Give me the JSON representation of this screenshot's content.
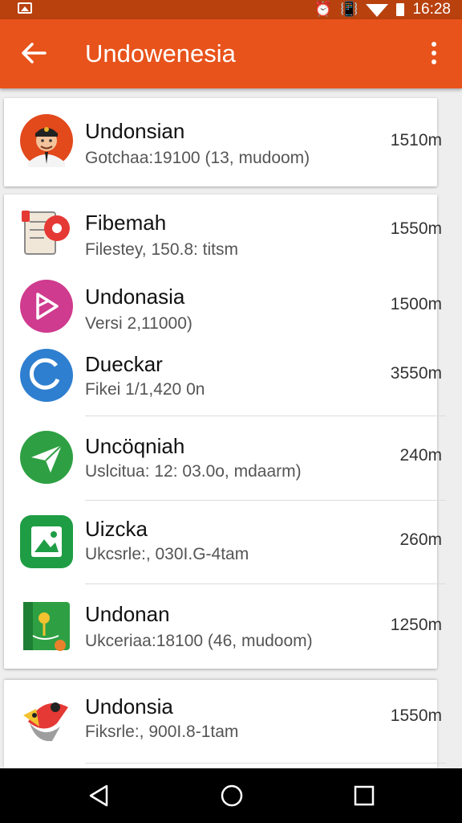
{
  "status_bar": {
    "time": "16:28",
    "icons": [
      "image-icon",
      "alarm-icon",
      "vibrate-icon",
      "wifi-icon",
      "battery-icon"
    ]
  },
  "app_bar": {
    "title": "Undowenesia",
    "back_icon": "arrow-back-icon",
    "menu_icon": "more-vert-icon"
  },
  "colors": {
    "app_bar": "#e8531b",
    "status_bar": "#b8410e"
  },
  "items": [
    {
      "title": "Undonsian",
      "subtitle": "Gotchaa:19100 (13, mudoom)",
      "size": "1510m",
      "icon": "avatar-icon"
    },
    {
      "title": "Fibemah",
      "subtitle": "Filestey, 150.8: titsm",
      "size": "1550m",
      "icon": "document-icon"
    },
    {
      "title": "Undonasia",
      "subtitle": "Versi 2,11000)",
      "size": "1500m",
      "icon": "media-play-icon"
    },
    {
      "title": "Dueckar",
      "subtitle": "Fikei 1/1,420 0n",
      "size": "3550m",
      "icon": "refresh-icon"
    },
    {
      "title": "Uncöqniah",
      "subtitle": "Uslcitua: 12: 03.0o, mdaarm)",
      "size": "240m",
      "icon": "send-icon"
    },
    {
      "title": "Uizcka",
      "subtitle": "Ukcsrle:, 030I.G-4tam",
      "size": "260m",
      "icon": "gallery-icon"
    },
    {
      "title": "Undonan",
      "subtitle": "Ukceriaa:18100 (46, mudoom)",
      "size": "1250m",
      "icon": "map-book-icon"
    },
    {
      "title": "Undonsia",
      "subtitle": "Fiksrle:, 900I.8-1tam",
      "size": "1550m",
      "icon": "bird-icon"
    }
  ],
  "nav_bar": {
    "back": "nav-back-icon",
    "home": "nav-home-icon",
    "recents": "nav-recents-icon"
  }
}
